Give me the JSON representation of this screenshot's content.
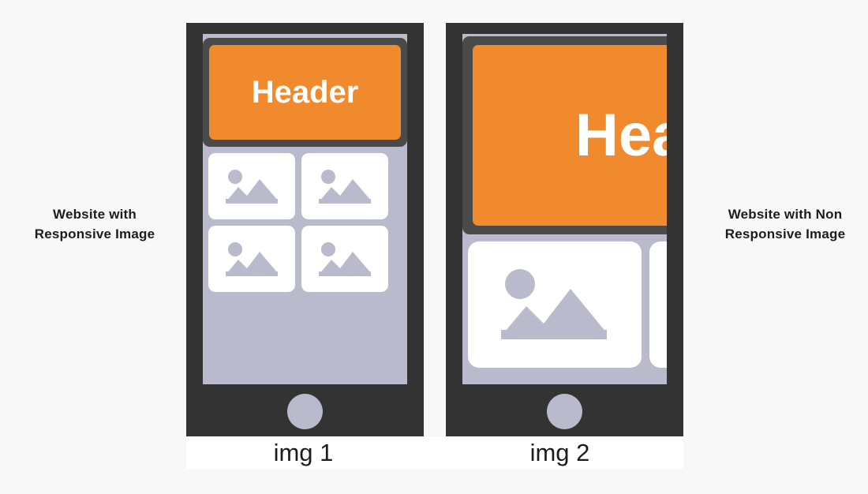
{
  "background_color": "#f8f8f8",
  "colors": {
    "phone_frame": "#333333",
    "screen": "#b9bacb",
    "header_shell": "#4a4a4a",
    "header_accent": "#f1892d",
    "card": "#ffffff",
    "placeholder_glyph": "#b9bacb",
    "text": "#1c1c1c"
  },
  "annotations": {
    "left": "Website with Responsive Image",
    "right": "Website with Non Responsive Image"
  },
  "phones": [
    {
      "id": "responsive",
      "header_text": "Header",
      "caption": "img 1",
      "cards": [
        {
          "icon": "image-placeholder-icon"
        },
        {
          "icon": "image-placeholder-icon"
        },
        {
          "icon": "image-placeholder-icon"
        },
        {
          "icon": "image-placeholder-icon"
        }
      ]
    },
    {
      "id": "non-responsive",
      "header_text": "Header",
      "caption": "img 2",
      "cards": [
        {
          "icon": "image-placeholder-icon"
        },
        {
          "icon": "image-placeholder-icon"
        }
      ]
    }
  ]
}
